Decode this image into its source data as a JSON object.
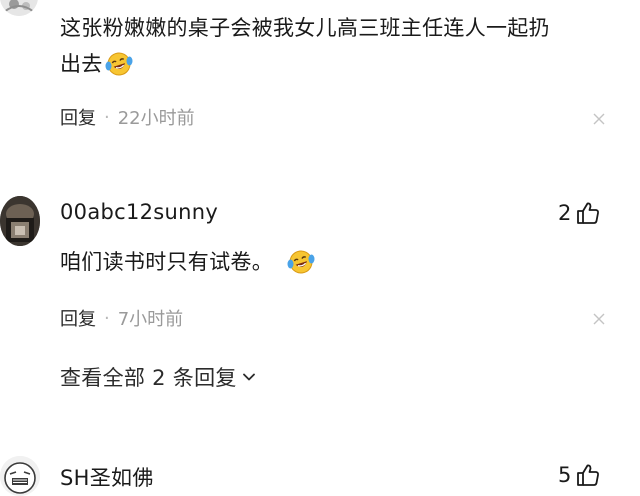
{
  "comments": [
    {
      "text": "这张粉嫩嫩的桌子会被我女儿高三班主任连人一起扔",
      "text_line2": "出去",
      "emoji": "laughing-crying-emoji",
      "reply_label": "回复",
      "separator": "·",
      "time": "22小时前"
    },
    {
      "username": "00abc12sunny",
      "likes": "2",
      "text": "咱们读书时只有试卷。",
      "emoji": "laughing-crying-emoji",
      "reply_label": "回复",
      "separator": "·",
      "time": "7小时前",
      "view_replies": "查看全部 2 条回复"
    },
    {
      "username": "SH圣如佛",
      "likes": "5"
    }
  ],
  "icons": {
    "like": "thumbs-up-icon",
    "close": "close-icon",
    "expand": "chevron-down-icon"
  },
  "colors": {
    "text": "#1a1a1a",
    "meta": "#9a9a9a",
    "emoji_face": "#f7c531",
    "emoji_tear": "#4aa3e8"
  }
}
